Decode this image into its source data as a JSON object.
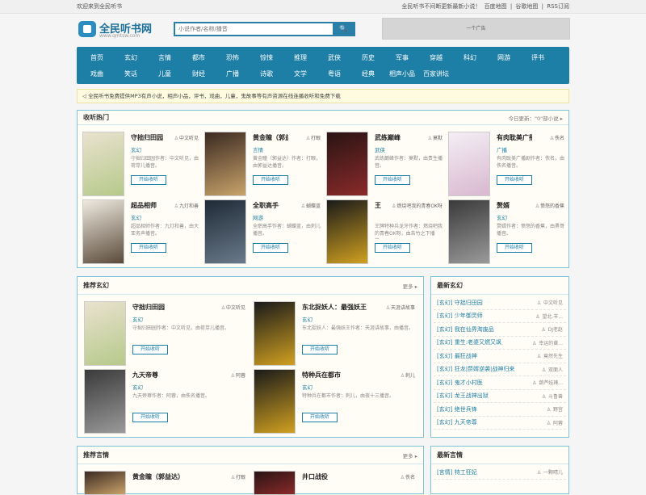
{
  "topbar": {
    "welcome": "欢迎来到全民听书",
    "slogan": "全民听书不间断更新最新小说！",
    "links": [
      "百度地图",
      "|",
      "谷歌地图",
      "|",
      "RSS订阅"
    ]
  },
  "logo": {
    "name": "全民听书网",
    "domain": "www.qmtsw.com"
  },
  "search": {
    "placeholder": "小说作者/名称/播音"
  },
  "ad": "一个广告",
  "nav": {
    "row1": [
      "首页",
      "玄幻",
      "言情",
      "都市",
      "恐怖",
      "惊悚",
      "推理",
      "武侠",
      "历史",
      "军事",
      "穿越",
      "科幻",
      "网游",
      "评书"
    ],
    "row2": [
      "戏曲",
      "笑话",
      "儿童",
      "财经",
      "广播",
      "诗歌",
      "文学",
      "粤语",
      "经典",
      "相声小品",
      "百家讲坛"
    ]
  },
  "notice": "全民听书免费提供MP3有声小说，相声小品，评书，戏曲，儿童，鬼故事等有声资源在线连播收听和免费下载",
  "hot": {
    "title": "收听热门",
    "more": "今日更新：\"0\"部小说",
    "books": [
      {
        "title": "守拙归田园",
        "author": "中文听见",
        "cat": "玄幻",
        "desc": "守拙归田园作者：中文听见，由荷芽儿播音。",
        "btn": "开始收听"
      },
      {
        "title": "黄金瞳（郭益…",
        "author": "打眼",
        "cat": "言情",
        "desc": "黄金瞳（郭益达）作者：打眼，由郭益达播音。",
        "btn": "开始收听"
      },
      {
        "title": "武练巅峰",
        "author": "莫默",
        "cat": "武侠",
        "desc": "武练巅峰作者：莫默，由贵生播音。",
        "btn": "开始收听"
      },
      {
        "title": "有肉耽美广播…",
        "author": "佚名",
        "cat": "广播",
        "desc": "有肉耽美广播剧作者：佚名，由佚名播音。",
        "btn": "开始收听"
      },
      {
        "title": "超品相师",
        "author": "九灯和善",
        "cat": "玄幻",
        "desc": "超品相师作者：九灯和善，由大亚务声播音。",
        "btn": "开始收听"
      },
      {
        "title": "全职高手",
        "author": "蝴蝶蓝",
        "cat": "网游",
        "desc": "全职高手作者：蝴蝶蓝，由刺儿播音。",
        "btn": "开始收听"
      },
      {
        "title": "王",
        "author": "燃烧吧我的青春OK呀",
        "cat": "",
        "desc": "王牌特种兵龙牙作者：燃烧吧我的青春OK呀，由苦竹之下播音。",
        "btn": "开始收听"
      },
      {
        "title": "赘婿",
        "author": "愤怒的香蕉",
        "cat": "玄幻",
        "desc": "赘婿作者：愤怒的香蕉，由勇哥播音。",
        "btn": "开始收听"
      }
    ]
  },
  "xuanhuan": {
    "title": "推荐玄幻",
    "more": "更多",
    "books": [
      {
        "title": "守拙归田园",
        "author": "中文听见",
        "cat": "玄幻",
        "desc": "守拙归田园作者：中文听见，由荷芽儿播音。",
        "btn": "开始收听"
      },
      {
        "title": "东北捉妖人：最强妖王",
        "author": "天涯讲故事",
        "cat": "玄幻",
        "desc": "东北捉妖人：最强妖王作者：天涯讲故事，由播音。",
        "btn": "开始收听"
      },
      {
        "title": "九天帝尊",
        "author": "阿蓉",
        "cat": "玄幻",
        "desc": "九天帝尊作者：阿蓉，由佚名播音。",
        "btn": "开始收听"
      },
      {
        "title": "特种兵在都市",
        "author": "刺儿",
        "cat": "玄幻",
        "desc": "特种兵在都市作者：刺儿，由夜十三播音。",
        "btn": "开始收听"
      }
    ]
  },
  "latest_xuanhuan": {
    "title": "最新玄幻",
    "items": [
      {
        "tag": "[玄幻]",
        "title": "守拙归田园",
        "author": "中文听见"
      },
      {
        "tag": "[玄幻]",
        "title": "少年御灵师",
        "author": "望北.羊..."
      },
      {
        "tag": "[玄幻]",
        "title": "我在仙界淘废品",
        "author": "DJ老赵"
      },
      {
        "tag": "[玄幻]",
        "title": "重生:老婆又燃又飒",
        "author": "幸运的黄..."
      },
      {
        "tag": "[玄幻]",
        "title": "最狂战神",
        "author": "竟然先生"
      },
      {
        "tag": "[玄幻]",
        "title": "狂龙|赘婿逆袭|战神归来",
        "author": "双面人"
      },
      {
        "tag": "[玄幻]",
        "title": "鬼才小村医",
        "author": "葫芦娃辣..."
      },
      {
        "tag": "[玄幻]",
        "title": "龙王战神出狱",
        "author": "斗鲁兽"
      },
      {
        "tag": "[玄幻]",
        "title": "绝世兵锋",
        "author": "野宫"
      },
      {
        "tag": "[玄幻]",
        "title": "九天帝尊",
        "author": "阿蓉"
      }
    ]
  },
  "yanqing": {
    "title": "推荐言情",
    "more": "更多",
    "books": [
      {
        "title": "黄金瞳（郭益达）",
        "author": "打眼"
      },
      {
        "title": "井口战役",
        "author": "佚名"
      }
    ]
  },
  "latest_yanqing": {
    "title": "最新言情",
    "items": [
      {
        "tag": "[言情]",
        "title": "特工狂妃",
        "author": "一颗晴儿"
      }
    ]
  }
}
